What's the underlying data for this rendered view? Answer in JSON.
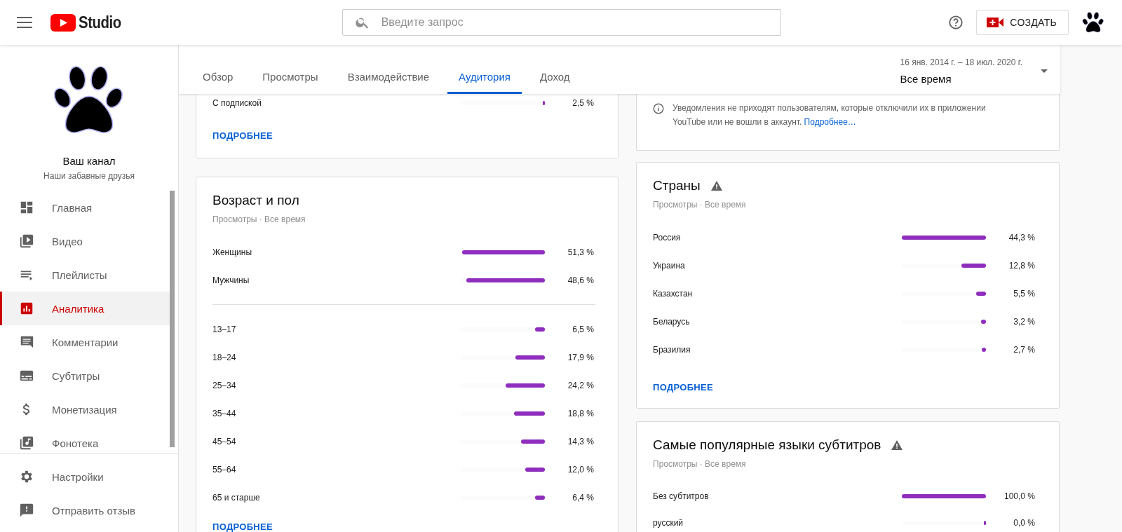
{
  "header": {
    "logo_text": "Studio",
    "search": {
      "placeholder": "Введите запрос"
    },
    "create_button": "СОЗДАТЬ"
  },
  "sidebar": {
    "channel_name": "Ваш канал",
    "channel_description": "Наши забавные друзья",
    "items": [
      {
        "label": "Главная",
        "kind": "dashboard",
        "selected": false
      },
      {
        "label": "Видео",
        "kind": "video",
        "selected": false
      },
      {
        "label": "Плейлисты",
        "kind": "playlist",
        "selected": false
      },
      {
        "label": "Аналитика",
        "kind": "analytics",
        "selected": true
      },
      {
        "label": "Комментарии",
        "kind": "comments",
        "selected": false
      },
      {
        "label": "Субтитры",
        "kind": "subtitles",
        "selected": false
      },
      {
        "label": "Монетизация",
        "kind": "money",
        "selected": false
      },
      {
        "label": "Фонотека",
        "kind": "music",
        "selected": false
      }
    ],
    "bottom_items": [
      {
        "label": "Настройки",
        "kind": "settings",
        "selected": false
      },
      {
        "label": "Отправить отзыв",
        "kind": "feedback",
        "selected": false
      }
    ]
  },
  "tabs": [
    {
      "label": "Обзор",
      "selected": false
    },
    {
      "label": "Просмотры",
      "selected": false
    },
    {
      "label": "Взаимодействие",
      "selected": false
    },
    {
      "label": "Аудитория",
      "selected": true
    },
    {
      "label": "Доход",
      "selected": false
    }
  ],
  "date_range": {
    "range": "16 янв. 2014 г. – 18 июл. 2020 г.",
    "period": "Все время"
  },
  "columns": [
    {
      "cards": [
        {
          "kind": "partial",
          "groups": [
            [
              {
                "label": "С подпиской",
                "level": 0.02,
                "value": "2,5 %"
              }
            ]
          ],
          "link": "ПОДРОБНЕЕ"
        },
        {
          "kind": "card",
          "title": "Возраст и пол",
          "warning": false,
          "subtitle": "Просмотры · Все время",
          "groups": [
            [
              {
                "label": "Женщины",
                "level": 0.98,
                "value": "51,3 %"
              },
              {
                "label": "Мужчины",
                "level": 0.93,
                "value": "48,6 %"
              }
            ],
            [
              {
                "label": "13–17",
                "level": 0.12,
                "value": "6,5 %"
              },
              {
                "label": "18–24",
                "level": 0.35,
                "value": "17,9 %"
              },
              {
                "label": "25–34",
                "level": 0.47,
                "value": "24,2 %"
              },
              {
                "label": "35–44",
                "level": 0.37,
                "value": "18,8 %"
              },
              {
                "label": "45–54",
                "level": 0.28,
                "value": "14,3 %"
              },
              {
                "label": "55–64",
                "level": 0.23,
                "value": "12,0 %"
              },
              {
                "label": "65 и старше",
                "level": 0.12,
                "value": "6,4 %"
              }
            ]
          ],
          "link": "ПОДРОБНЕЕ"
        }
      ]
    },
    {
      "cards": [
        {
          "kind": "note",
          "text": "Уведомления не приходят пользователям, которые отключили их в приложении YouTube или не вошли в аккаунт.",
          "link": "Подробнее…"
        },
        {
          "kind": "card",
          "title": "Страны",
          "warning": true,
          "subtitle": "Просмотры · Все время",
          "groups": [
            [
              {
                "label": "Россия",
                "level": 1.0,
                "value": "44,3 %"
              },
              {
                "label": "Украина",
                "level": 0.29,
                "value": "12,8 %"
              },
              {
                "label": "Казахстан",
                "level": 0.12,
                "value": "5,5 %"
              },
              {
                "label": "Беларусь",
                "level": 0.06,
                "value": "3,2 %"
              },
              {
                "label": "Бразилия",
                "level": 0.05,
                "value": "2,7 %"
              }
            ]
          ],
          "link": "ПОДРОБНЕЕ"
        },
        {
          "kind": "card",
          "title": "Самые популярные языки субтитров",
          "warning": true,
          "subtitle": "Просмотры · Все время",
          "groups": [
            [
              {
                "label": "Без субтитров",
                "level": 1.0,
                "value": "100,0 %"
              },
              {
                "label": "русский",
                "level": 0.01,
                "value": "0,0 %"
              }
            ]
          ]
        }
      ]
    }
  ]
}
